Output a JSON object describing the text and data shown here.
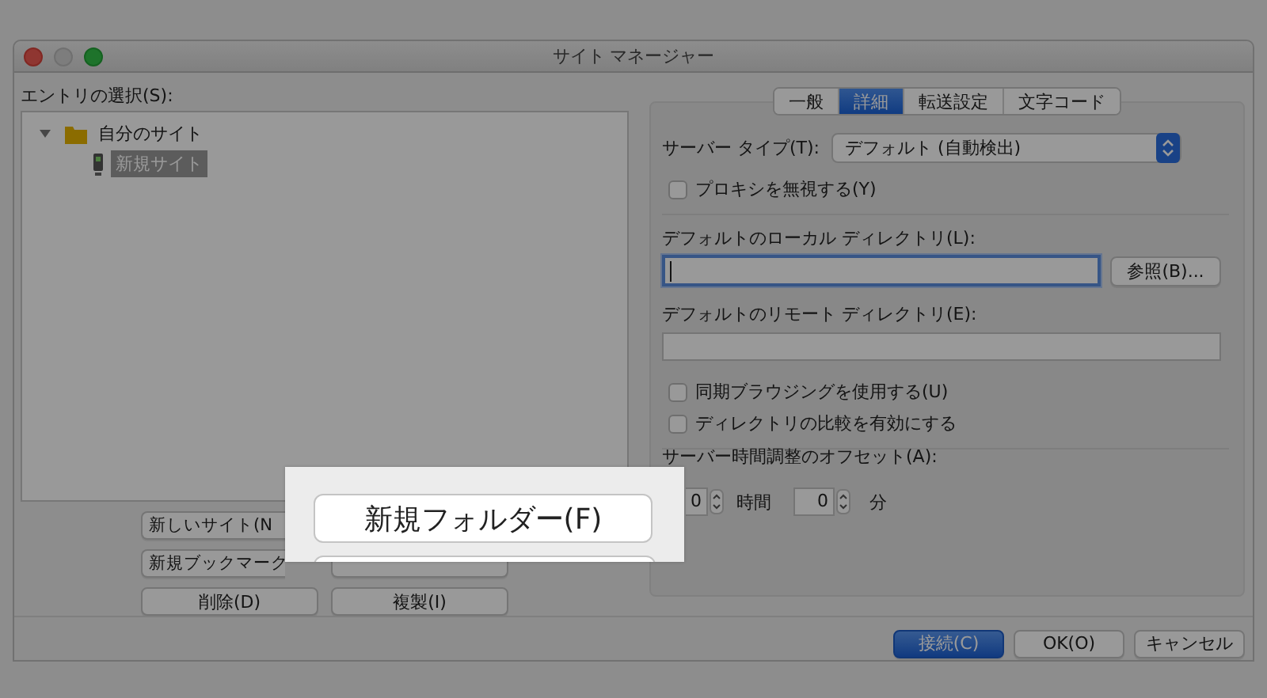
{
  "window": {
    "title": "サイト マネージャー"
  },
  "entry_label": "エントリの選択(S):",
  "tree": [
    {
      "label": "自分のサイト",
      "expanded": true,
      "selected": false,
      "children": [
        {
          "label": "新規サイト",
          "selected": true
        }
      ]
    }
  ],
  "site_buttons": [
    {
      "label": "新しいサイト(N"
    },
    {
      "label": "新規ブックマーク"
    },
    {
      "label": "削除(D)"
    },
    {
      "label": "複製(I)"
    }
  ],
  "tabs": [
    {
      "label": "一般",
      "selected": false
    },
    {
      "label": "詳細",
      "selected": true
    },
    {
      "label": "転送設定",
      "selected": false
    },
    {
      "label": "文字コード",
      "selected": false
    }
  ],
  "server_type": {
    "label": "サーバー タイプ(T):",
    "value": "デフォルト (自動検出)"
  },
  "bypass_proxy": {
    "label": "プロキシを無視する(Y)",
    "checked": false
  },
  "local_dir": {
    "label": "デフォルトのローカル ディレクトリ(L):",
    "focused": true,
    "browse": "参照(B)..."
  },
  "remote_dir": {
    "label": "デフォルトのリモート ディレクトリ(E):"
  },
  "options": [
    {
      "label": "同期ブラウジングを使用する(U)",
      "checked": false
    },
    {
      "label": "ディレクトリの比較を有効にする",
      "checked": false
    }
  ],
  "offset": {
    "label": "サーバー時間調整のオフセット(A):",
    "hours": "0",
    "hours_unit": "時間",
    "minutes": "0",
    "minutes_unit": "分"
  },
  "dialog_buttons": [
    {
      "label": "接続(C)",
      "default": true
    },
    {
      "label": "OK(O)",
      "default": false
    },
    {
      "label": "キャンセル",
      "default": false
    }
  ],
  "callout": {
    "button": "新規フォルダー(F)"
  }
}
